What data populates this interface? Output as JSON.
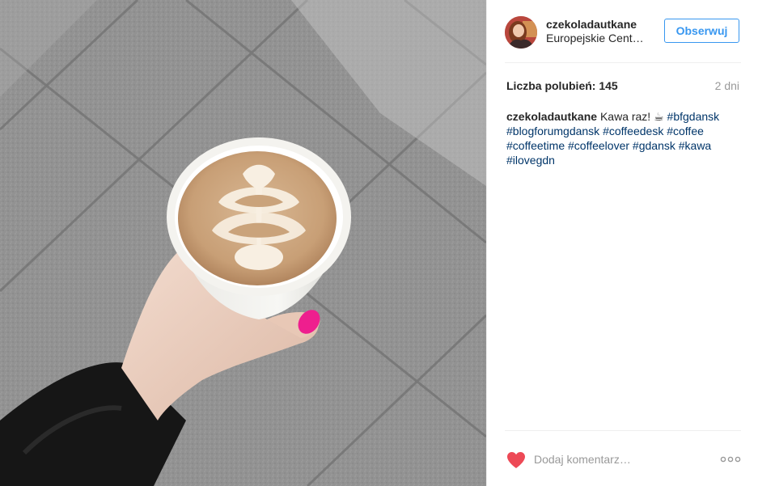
{
  "post": {
    "image_alt": "",
    "author": {
      "username": "czekoladautkane",
      "location": "Europejskie Cent…"
    },
    "follow_label": "Obserwuj",
    "likes_text": "Liczba polubień: 145",
    "time_text": "2 dni",
    "caption": {
      "username": "czekoladautkane",
      "text": "Kawa raz! ☕",
      "hashtags": [
        "#bfgdansk",
        "#blogforumgdansk",
        "#coffeedesk",
        "#coffee",
        "#coffeetime",
        "#coffeelover",
        "#gdansk",
        "#kawa",
        "#ilovegdn"
      ]
    },
    "comment_placeholder": "Dodaj komentarz…",
    "colors": {
      "accent": "#3897f0",
      "hashtag": "#003569",
      "like": "#ed4956",
      "muted": "#999999"
    },
    "icons": {
      "like": "heart-icon",
      "more": "more-options-icon"
    }
  }
}
